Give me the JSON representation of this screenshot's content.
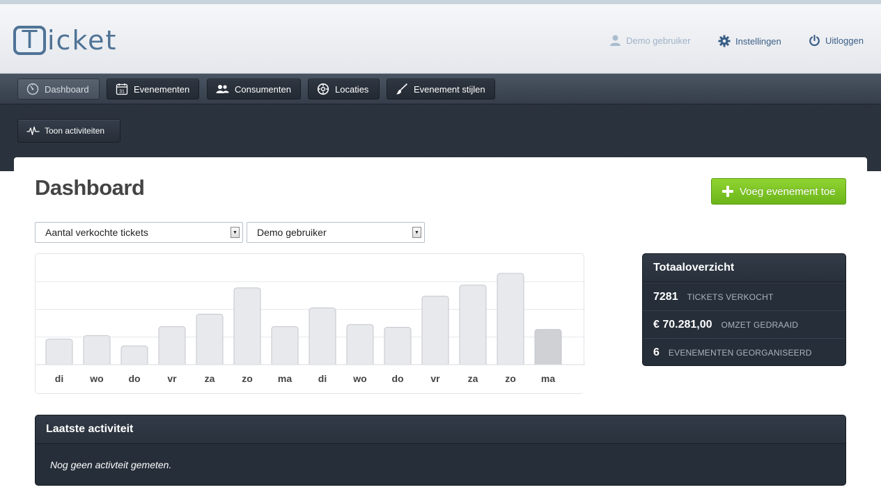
{
  "app": {
    "logo_letter": "T",
    "logo_rest": "icket"
  },
  "top_links": {
    "user": "Demo gebruiker",
    "settings": "Instellingen",
    "logout": "Uitloggen"
  },
  "nav": {
    "items": [
      {
        "label": "Dashboard",
        "icon": "dashboard-icon",
        "active": true
      },
      {
        "label": "Evenementen",
        "icon": "calendar-icon",
        "calendar_day": "31"
      },
      {
        "label": "Consumenten",
        "icon": "users-icon"
      },
      {
        "label": "Locaties",
        "icon": "compass-icon"
      },
      {
        "label": "Evenement stijlen",
        "icon": "brush-icon"
      }
    ]
  },
  "subnav": {
    "activity_button": "Toon activiteiten"
  },
  "page": {
    "title": "Dashboard",
    "add_button": "Voeg evenement toe"
  },
  "filters": {
    "metric": "Aantal verkochte tickets",
    "user": "Demo gebruiker"
  },
  "chart_data": {
    "type": "bar",
    "categories": [
      "di",
      "wo",
      "do",
      "vr",
      "za",
      "zo",
      "ma",
      "di",
      "wo",
      "do",
      "vr",
      "za",
      "zo",
      "ma"
    ],
    "values": [
      37,
      42,
      27,
      55,
      73,
      111,
      55,
      82,
      58,
      54,
      99,
      115,
      132,
      51
    ],
    "highlighted_index": 13,
    "ylim": [
      0,
      160
    ],
    "grid": true,
    "gridlines": 4,
    "colors": {
      "bar": "#e8e9ec",
      "bar_stroke": "#c3c6cc",
      "highlight": "#cfd1d5",
      "grid": "#e6e8eb"
    }
  },
  "summary": {
    "title": "Totaaloverzicht",
    "rows": [
      {
        "value": "7281",
        "label": "TICKETS VERKOCHT"
      },
      {
        "value": "€ 70.281,00",
        "label": "OMZET GEDRAAID"
      },
      {
        "value": "6",
        "label": "EVENEMENTEN GEORGANISEERD"
      }
    ]
  },
  "activity": {
    "title": "Laatste activiteit",
    "empty_text": "Nog geen activteit gemeten."
  },
  "colors": {
    "accent_green": "#7cc427",
    "dark_panel": "#262e39",
    "link_blue": "#3a5e86"
  }
}
